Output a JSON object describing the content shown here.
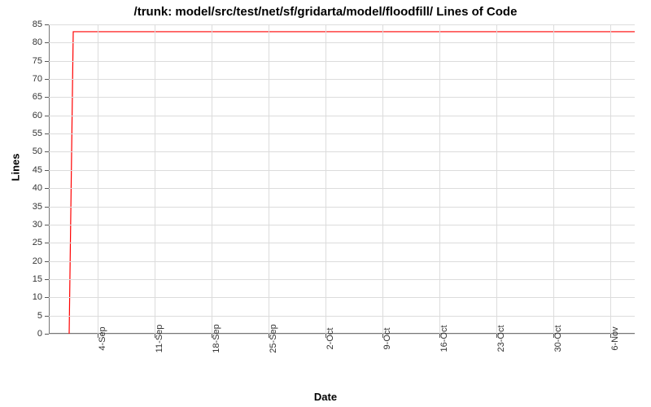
{
  "chart_data": {
    "type": "line",
    "title": "/trunk: model/src/test/net/sf/gridarta/model/floodfill/ Lines of Code",
    "xlabel": "Date",
    "ylabel": "Lines",
    "ylim": [
      0,
      85
    ],
    "y_ticks": [
      0,
      5,
      10,
      15,
      20,
      25,
      30,
      35,
      40,
      45,
      50,
      55,
      60,
      65,
      70,
      75,
      80,
      85
    ],
    "x_ticks": [
      "4-Sep",
      "11-Sep",
      "18-Sep",
      "25-Sep",
      "2-Oct",
      "9-Oct",
      "16-Oct",
      "23-Oct",
      "30-Oct",
      "6-Nov"
    ],
    "x_domain_days": 72,
    "x_tick_day_offsets": [
      6,
      13,
      20,
      27,
      34,
      41,
      48,
      55,
      62,
      69
    ],
    "series": [
      {
        "name": "lines",
        "color": "#ff0000",
        "points": [
          {
            "day": 2.5,
            "value": 0
          },
          {
            "day": 3.0,
            "value": 83
          },
          {
            "day": 72,
            "value": 83
          }
        ]
      }
    ]
  }
}
